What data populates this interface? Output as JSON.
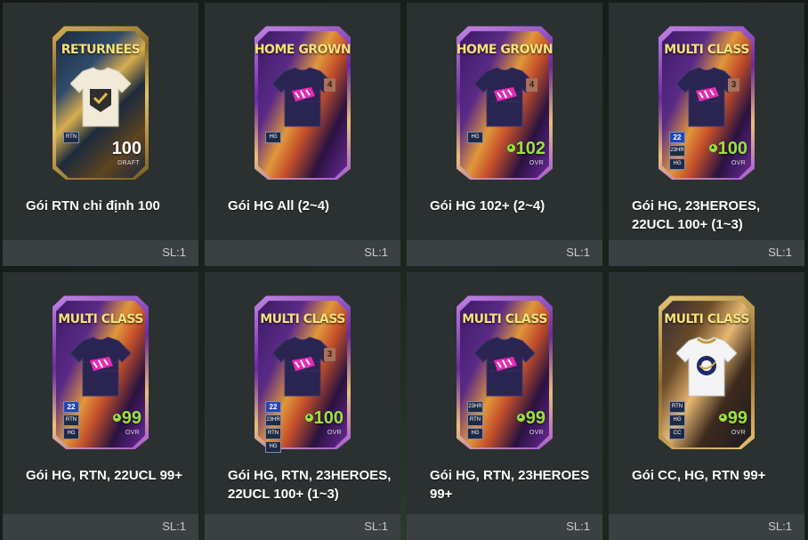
{
  "tiles": [
    {
      "title": "Gói RTN chỉ định 100",
      "sl": "SL:1",
      "card": {
        "style": "returnees",
        "label": "RETURNEES",
        "rating": "100",
        "rating_sub": "DRAFT",
        "up_arrow": false,
        "tags": [
          "RTN"
        ],
        "shirt": "cream",
        "badge_num": ""
      }
    },
    {
      "title": "Gói HG All (2~4)",
      "sl": "SL:1",
      "card": {
        "style": "purple",
        "label": "HOME GROWN",
        "rating": "",
        "rating_sub": "",
        "up_arrow": false,
        "tags": [
          "HG"
        ],
        "shirt": "navy",
        "badge_num": "4"
      }
    },
    {
      "title": "Gói HG 102+ (2~4)",
      "sl": "SL:1",
      "card": {
        "style": "purple",
        "label": "HOME GROWN",
        "rating": "102",
        "rating_sub": "OVR",
        "up_arrow": true,
        "tags": [
          "HG"
        ],
        "shirt": "navy",
        "badge_num": "4"
      }
    },
    {
      "title": "Gói HG, 23HEROES, 22UCL 100+ (1~3)",
      "sl": "SL:1",
      "card": {
        "style": "purple",
        "label": "MULTI CLASS",
        "rating": "100",
        "rating_sub": "OVR",
        "up_arrow": true,
        "tags": [
          "22",
          "23HR",
          "HG"
        ],
        "shirt": "navy",
        "badge_num": "3"
      }
    },
    {
      "title": "Gói HG, RTN, 22UCL 99+",
      "sl": "SL:1",
      "card": {
        "style": "purple",
        "label": "MULTI CLASS",
        "rating": "99",
        "rating_sub": "OVR",
        "up_arrow": true,
        "tags": [
          "22",
          "RTN",
          "HG"
        ],
        "shirt": "navy",
        "badge_num": ""
      }
    },
    {
      "title": "Gói HG, RTN, 23HEROES, 22UCL 100+ (1~3)",
      "sl": "SL:1",
      "card": {
        "style": "purple",
        "label": "MULTI CLASS",
        "rating": "100",
        "rating_sub": "OVR",
        "up_arrow": true,
        "tags": [
          "22",
          "23HR",
          "RTN",
          "HG"
        ],
        "shirt": "navy",
        "badge_num": "3"
      }
    },
    {
      "title": "Gói HG, RTN, 23HEROES 99+",
      "sl": "SL:1",
      "card": {
        "style": "purple",
        "label": "MULTI CLASS",
        "rating": "99",
        "rating_sub": "OVR",
        "up_arrow": true,
        "tags": [
          "23HR",
          "RTN",
          "HG"
        ],
        "shirt": "navy",
        "badge_num": ""
      }
    },
    {
      "title": "Gói CC, HG, RTN 99+",
      "sl": "SL:1",
      "card": {
        "style": "cc",
        "label": "MULTI CLASS",
        "rating": "99",
        "rating_sub": "OVR",
        "up_arrow": true,
        "tags": [
          "RTN",
          "HG",
          "CC"
        ],
        "shirt": "white",
        "badge_num": ""
      }
    }
  ],
  "colors": {
    "tile_bg": "#2b3031",
    "footer_bg": "#3b4142",
    "rating_green": "#9ae33a",
    "label_gold": "#f6e27a"
  }
}
